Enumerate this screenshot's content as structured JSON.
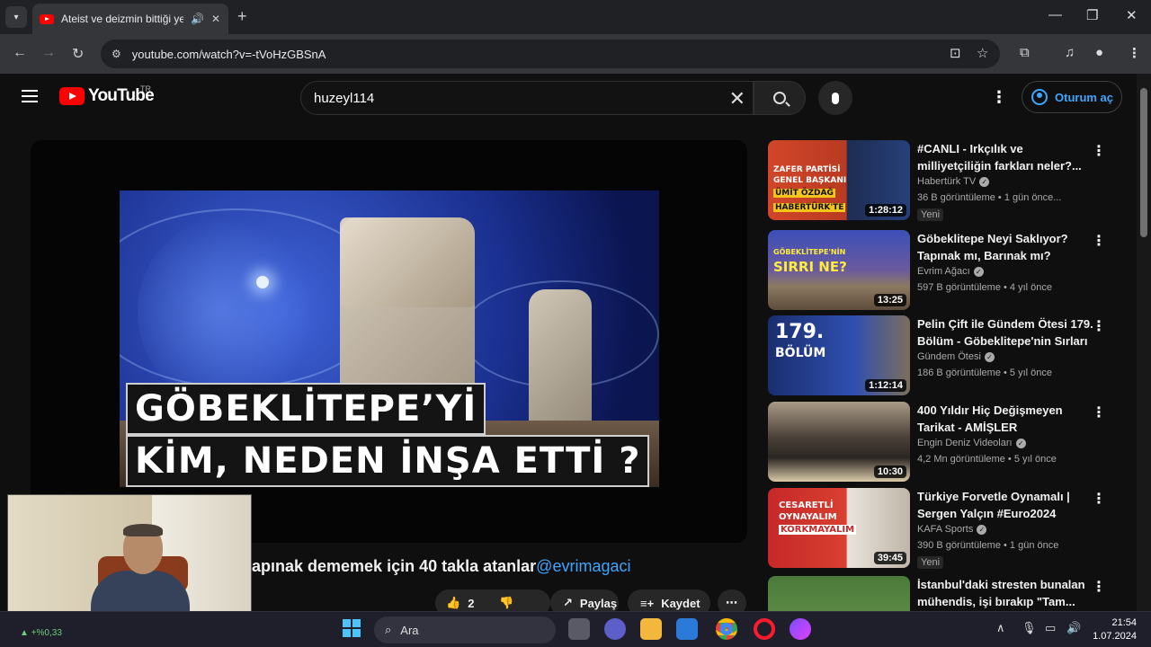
{
  "browser": {
    "tab_title": "Ateist ve deizmin bittiği yer",
    "url": "youtube.com/watch?v=-tVoHzGBSnA"
  },
  "youtube": {
    "logo_text": "YouTube",
    "country_code": "TR",
    "search_value": "huzeyl114",
    "signin_label": "Oturum aç"
  },
  "video": {
    "thumb_line1": "GÖBEKLİTEPE’Yİ",
    "thumb_line2": "KİM, NEDEN İNŞA ETTİ ?",
    "title_visible": "apınak dememek için 40 takla atanlar",
    "title_tag": "@evrimagaci",
    "like_count": "2",
    "share_label": "Paylaş",
    "save_label": "Kaydet"
  },
  "recommendations": [
    {
      "title": "#CANLI - Irkçılık ve milliyetçiliğin farkları neler?...",
      "channel": "Habertürk TV",
      "views": "36 B görüntüleme",
      "age": "1 gün önce...",
      "duration": "1:28:12",
      "badge": "Yeni",
      "thumb_texts": [
        "ZAFER PARTİSİ",
        "GENEL BAŞKANI",
        "ÜMİT ÖZDAĞ",
        "HABERTÜRK'TE"
      ]
    },
    {
      "title": "Göbeklitepe Neyi Saklıyor? Tapınak mı, Barınak mı?",
      "channel": "Evrim Ağacı",
      "views": "597 B görüntüleme",
      "age": "4 yıl önce",
      "duration": "13:25",
      "badge": "",
      "thumb_texts": [
        "GÖBEKLİTEPE'NİN",
        "SIRRI NE?"
      ]
    },
    {
      "title": "Pelin Çift ile Gündem Ötesi 179. Bölüm - Göbeklitepe'nin Sırları",
      "channel": "Gündem Ötesi",
      "views": "186 B görüntüleme",
      "age": "5 yıl önce",
      "duration": "1:12:14",
      "badge": "",
      "thumb_texts": [
        "179.",
        "BÖLÜM"
      ]
    },
    {
      "title": "400 Yıldır Hiç Değişmeyen Tarikat - AMİŞLER",
      "channel": "Engin Deniz Videoları",
      "views": "4,2 Mn görüntüleme",
      "age": "5 yıl önce",
      "duration": "10:30",
      "badge": "",
      "thumb_texts": []
    },
    {
      "title": "Türkiye Forvetle Oynamalı | Sergen Yalçın #Euro2024",
      "channel": "KAFA Sports",
      "views": "390 B görüntüleme",
      "age": "1 gün önce",
      "duration": "39:45",
      "badge": "Yeni",
      "thumb_texts": [
        "CESARETLİ",
        "OYNAYALIM",
        "KORKMAYALIM"
      ]
    },
    {
      "title": "İstanbul'daki stresten bunalan mühendis, işi bırakıp \"Tam...",
      "channel": "",
      "views": "",
      "age": "",
      "duration": "",
      "badge": "",
      "thumb_texts": []
    }
  ],
  "taskbar": {
    "search_label": "Ara",
    "time": "21:54",
    "date": "1.07.2024",
    "stock_change": "+%0,33"
  },
  "colors": {
    "accent_blue": "#3ea6ff",
    "youtube_red": "#ff0000",
    "background": "#0f0f0f"
  }
}
